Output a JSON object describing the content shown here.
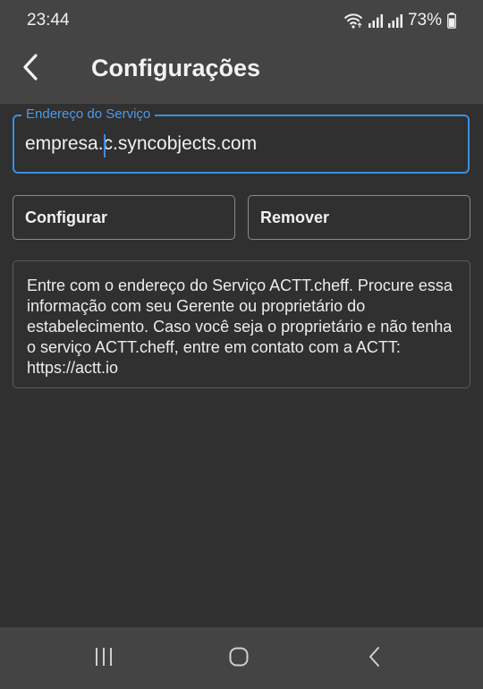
{
  "status_bar": {
    "time": "23:44",
    "battery": "73%",
    "icons": [
      "wifi-icon",
      "signal-icon",
      "signal-icon",
      "battery-icon"
    ]
  },
  "app_bar": {
    "back_icon": "chevron-left-icon",
    "title": "Configurações"
  },
  "service_field": {
    "label": "Endereço do Serviço",
    "value": "empresa.c.syncobjects.com",
    "accent_color": "#3a8fe0"
  },
  "buttons": {
    "configure_label": "Configurar",
    "remove_label": "Remover"
  },
  "info": {
    "text": "Entre com o endereço do Serviço ACTT.cheff. Procure essa informação com seu Gerente ou proprietário do estabelecimento. Caso você seja o proprietário e não tenha o serviço ACTT.cheff, entre em contato com a ACTT: https://actt.io"
  },
  "nav_bar": {
    "icons": [
      "recent-apps-icon",
      "home-icon",
      "back-icon"
    ]
  },
  "colors": {
    "background": "#303030",
    "bars": "#444444",
    "accent": "#3a8fe0"
  }
}
